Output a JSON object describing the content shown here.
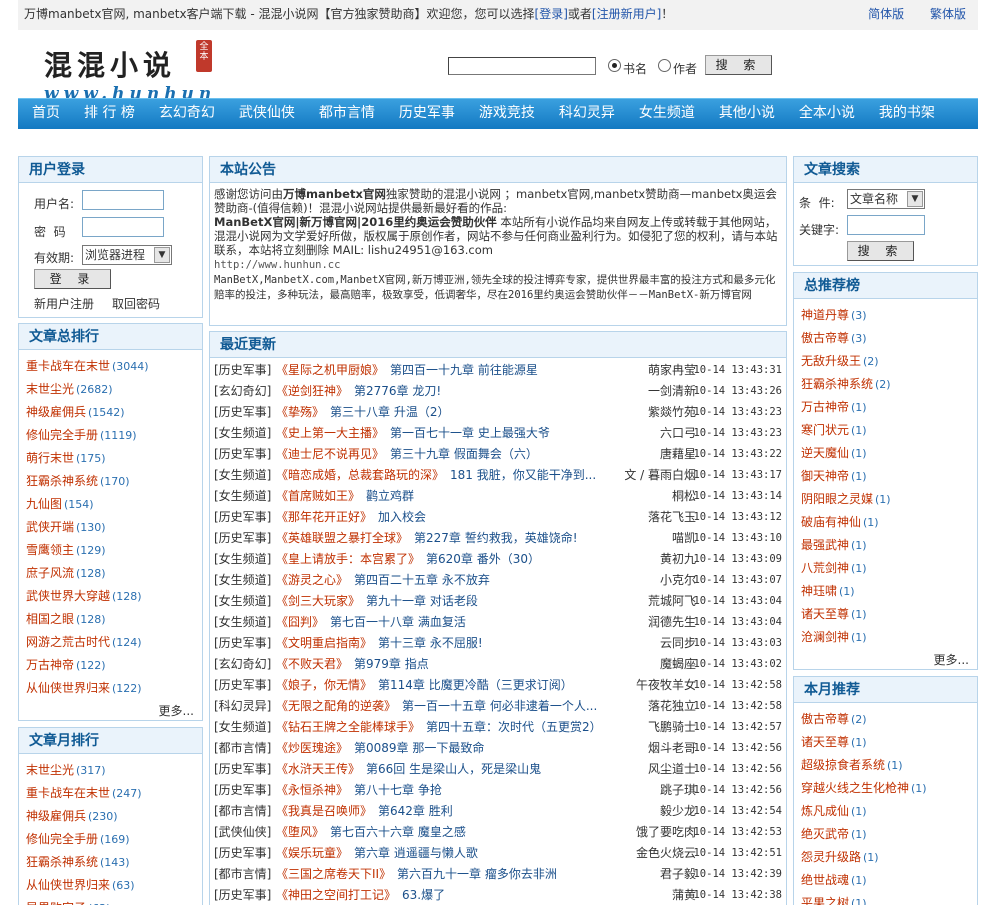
{
  "topbar": {
    "welcome_prefix": "万博manbetx官网, manbetx客户端下载 - 混混小说网【官方独家赞助商】欢迎您，您可以选择",
    "login": "[登录]",
    "or": "或者",
    "register": "[注册新用户]",
    "suffix": "！",
    "simplified": "简体版",
    "traditional": "繁体版"
  },
  "logo": {
    "name": "混混小说",
    "seal": "全本",
    "url": "www.hunhun.cc"
  },
  "search": {
    "value": "",
    "radio_book": "书名",
    "radio_author": "作者",
    "button": "搜 索"
  },
  "nav": [
    "首页",
    "排 行 榜",
    "玄幻奇幻",
    "武侠仙侠",
    "都市言情",
    "历史军事",
    "游戏竞技",
    "科幻灵异",
    "女生频道",
    "其他小说",
    "全本小说",
    "我的书架"
  ],
  "login_box": {
    "title": "用户登录",
    "user_label": "用户名:",
    "pwd_label": "密  码",
    "expire_label": "有效期:",
    "expire_value": "浏览器进程",
    "login_button": "登 录",
    "register_link": "新用户注册",
    "forgot_link": "取回密码"
  },
  "total_rank": {
    "title": "文章总排行",
    "more": "更多...",
    "items": [
      {
        "name": "重卡战车在末世",
        "count": "(3044)"
      },
      {
        "name": "末世尘光",
        "count": "(2682)"
      },
      {
        "name": "神级雇佣兵",
        "count": "(1542)"
      },
      {
        "name": "修仙完全手册",
        "count": "(1119)"
      },
      {
        "name": "萌行末世",
        "count": "(175)"
      },
      {
        "name": "狂霸杀神系统",
        "count": "(170)"
      },
      {
        "name": "九仙图",
        "count": "(154)"
      },
      {
        "name": "武侠开端",
        "count": "(130)"
      },
      {
        "name": "雪鹰领主",
        "count": "(129)"
      },
      {
        "name": "庶子风流",
        "count": "(128)"
      },
      {
        "name": "武侠世界大穿越",
        "count": "(128)"
      },
      {
        "name": "相国之眼",
        "count": "(128)"
      },
      {
        "name": "网游之荒古时代",
        "count": "(124)"
      },
      {
        "name": "万古神帝",
        "count": "(122)"
      },
      {
        "name": "从仙侠世界归来",
        "count": "(122)"
      }
    ]
  },
  "month_rank": {
    "title": "文章月排行",
    "items": [
      {
        "name": "末世尘光",
        "count": "(317)"
      },
      {
        "name": "重卡战车在末世",
        "count": "(247)"
      },
      {
        "name": "神级雇佣兵",
        "count": "(230)"
      },
      {
        "name": "修仙完全手册",
        "count": "(169)"
      },
      {
        "name": "狂霸杀神系统",
        "count": "(143)"
      },
      {
        "name": "从仙侠世界归来",
        "count": "(63)"
      },
      {
        "name": "异界败家子",
        "count": "(62)"
      }
    ]
  },
  "notice": {
    "title": "本站公告",
    "l1a": "感谢您访问由",
    "l1b": "万博manbetx官网",
    "l1c": "独家赞助的混混小说网 ；manbetx官网,manbetx赞助商—manbetx奥运会赞助商-(值得信赖)！混混小说网站提供最新最好看的作品:",
    "l2a": "ManBetX官网|新万博官网|2016里约奥运会赞助伙伴",
    "l2b": " 本站所有小说作品均来自网友上传或转载于其他网站，混混小说网为文学爱好所做，版权属于原创作者，网站不参与任何商业盈利行为。如侵犯了您的权利，请与本站联系，本站将立刻删除 MAIL: lishu24951@163.com",
    "l3": "http://www.hunhun.cc",
    "l4": "ManBetX,ManbetX.com,ManbetX官网,新万博亚洲,领先全球的投注博弈专家，提供世界最丰富的投注方式和最多元化赔率的投注，多种玩法，最高赔率，极致享受，低调奢华，尽在2016里约奥运会赞助伙伴－－ManBetX-新万博官网"
  },
  "updates": {
    "title": "最近更新",
    "rows": [
      {
        "cat": "[历史军事]",
        "title": "《星际之机甲厨娘》",
        "chapter": "第四百一十九章 前往能源星",
        "author": "萌家冉莹",
        "time": "10-14 13:43:31"
      },
      {
        "cat": "[玄幻奇幻]",
        "title": "《逆剑狂神》",
        "chapter": "第2776章 龙刀!",
        "author": "一剑清新",
        "time": "10-14 13:43:26"
      },
      {
        "cat": "[历史军事]",
        "title": "《挚殇》",
        "chapter": "第三十八章 升温（2）",
        "author": "紫燚竹苑",
        "time": "10-14 13:43:23"
      },
      {
        "cat": "[女生频道]",
        "title": "《史上第一大主播》",
        "chapter": "第一百七十一章 史上最强大爷",
        "author": "六口弓",
        "time": "10-14 13:43:23"
      },
      {
        "cat": "[历史军事]",
        "title": "《迪士尼不说再见》",
        "chapter": "第三十九章 假面舞会（六）",
        "author": "唐藉星",
        "time": "10-14 13:43:22"
      },
      {
        "cat": "[女生频道]",
        "title": "《暗恋成婚，总裁套路玩的深》",
        "chapter": "181 我脏，你又能干净到...",
        "author": "文 / 暮雨白烟",
        "time": "10-14 13:43:17"
      },
      {
        "cat": "[女生频道]",
        "title": "《首席贼如王》",
        "chapter": "鹳立鸡群",
        "author": "桐松",
        "time": "10-14 13:43:14"
      },
      {
        "cat": "[历史军事]",
        "title": "《那年花开正好》",
        "chapter": "加入校会",
        "author": "落花飞玉",
        "time": "10-14 13:43:12"
      },
      {
        "cat": "[历史军事]",
        "title": "《英雄联盟之暴打全球》",
        "chapter": "第227章 誓约救我，英雄饶命!",
        "author": "喵凯",
        "time": "10-14 13:43:10"
      },
      {
        "cat": "[女生频道]",
        "title": "《皇上请放手：本宫累了》",
        "chapter": "第620章 番外（30）",
        "author": "黄初九",
        "time": "10-14 13:43:09"
      },
      {
        "cat": "[女生频道]",
        "title": "《游灵之心》",
        "chapter": "第四百二十五章 永不放弃",
        "author": "小克尔",
        "time": "10-14 13:43:07"
      },
      {
        "cat": "[女生频道]",
        "title": "《剑三大玩家》",
        "chapter": "第九十一章 对话老段",
        "author": "荒城阿飞",
        "time": "10-14 13:43:04"
      },
      {
        "cat": "[女生频道]",
        "title": "《囧判》",
        "chapter": "第七百一十八章 满血复活",
        "author": "润德先生",
        "time": "10-14 13:43:04"
      },
      {
        "cat": "[历史军事]",
        "title": "《文明重启指南》",
        "chapter": "第十三章 永不屈服!",
        "author": "云同步",
        "time": "10-14 13:43:03"
      },
      {
        "cat": "[玄幻奇幻]",
        "title": "《不败天君》",
        "chapter": "第979章 指点",
        "author": "魔蝎座",
        "time": "10-14 13:43:02"
      },
      {
        "cat": "[历史军事]",
        "title": "《娘子，你无情》",
        "chapter": "第114章 比魔更冷酷（三更求订阅）",
        "author": "午夜牧羊女",
        "time": "10-14 13:42:58"
      },
      {
        "cat": "[科幻灵异]",
        "title": "《无限之配角的逆袭》",
        "chapter": "第一百一十五章 何必非逮着一个人...",
        "author": "落花独立",
        "time": "10-14 13:42:58"
      },
      {
        "cat": "[女生频道]",
        "title": "《钻石王牌之全能棒球手》",
        "chapter": "第四十五章：次时代（五更赏2）",
        "author": "飞鹏骑士",
        "time": "10-14 13:42:57"
      },
      {
        "cat": "[都市言情]",
        "title": "《炒医瑰途》",
        "chapter": "第0089章 那一下最致命",
        "author": "烟斗老哥",
        "time": "10-14 13:42:56"
      },
      {
        "cat": "[历史军事]",
        "title": "《水浒天王传》",
        "chapter": "第66回 生是梁山人，死是梁山鬼",
        "author": "风尘道士",
        "time": "10-14 13:42:56"
      },
      {
        "cat": "[历史军事]",
        "title": "《永恒杀神》",
        "chapter": "第八十七章 争抢",
        "author": "跳子琪",
        "time": "10-14 13:42:56"
      },
      {
        "cat": "[都市言情]",
        "title": "《我真是召唤师》",
        "chapter": "第642章 胜利",
        "author": "毅少龙",
        "time": "10-14 13:42:54"
      },
      {
        "cat": "[武侠仙侠]",
        "title": "《堕风》",
        "chapter": "第七百六十六章 魔皇之感",
        "author": "饿了要吃肉",
        "time": "10-14 13:42:53"
      },
      {
        "cat": "[历史军事]",
        "title": "《娱乐玩童》",
        "chapter": "第六章 逍遥疆与懒人歌",
        "author": "金色火烧云",
        "time": "10-14 13:42:51"
      },
      {
        "cat": "[都市言情]",
        "title": "《三国之席卷天下II》",
        "chapter": "第六百九十一章 瘤多你去非洲",
        "author": "君子毅",
        "time": "10-14 13:42:39"
      },
      {
        "cat": "[历史军事]",
        "title": "《神田之空间打工记》",
        "chapter": "63.爆了",
        "author": "蒲黄",
        "time": "10-14 13:42:38"
      }
    ]
  },
  "search_box": {
    "title": "文章搜索",
    "cond_label": "条  件:",
    "cond_value": "文章名称",
    "kw_label": "关键字:",
    "button": "搜 索"
  },
  "total_rec": {
    "title": "总推荐榜",
    "more": "更多...",
    "items": [
      {
        "name": "神道丹尊",
        "count": "(3)"
      },
      {
        "name": "傲古帝尊",
        "count": "(3)"
      },
      {
        "name": "无敌升级王",
        "count": "(2)"
      },
      {
        "name": "狂霸杀神系统",
        "count": "(2)"
      },
      {
        "name": "万古神帝",
        "count": "(1)"
      },
      {
        "name": "寒门状元",
        "count": "(1)"
      },
      {
        "name": "逆天魔仙",
        "count": "(1)"
      },
      {
        "name": "御天神帝",
        "count": "(1)"
      },
      {
        "name": "阴阳眼之灵媒",
        "count": "(1)"
      },
      {
        "name": "破庙有神仙",
        "count": "(1)"
      },
      {
        "name": "最强武神",
        "count": "(1)"
      },
      {
        "name": "八荒剑神",
        "count": "(1)"
      },
      {
        "name": "神珏啸",
        "count": "(1)"
      },
      {
        "name": "诸天至尊",
        "count": "(1)"
      },
      {
        "name": "沧澜剑神",
        "count": "(1)"
      }
    ]
  },
  "month_rec": {
    "title": "本月推荐",
    "items": [
      {
        "name": "傲古帝尊",
        "count": "(2)"
      },
      {
        "name": "诸天至尊",
        "count": "(1)"
      },
      {
        "name": "超级掠食者系统",
        "count": "(1)"
      },
      {
        "name": "穿越火线之生化枪神",
        "count": "(1)"
      },
      {
        "name": "炼凡成仙",
        "count": "(1)"
      },
      {
        "name": "绝灭武帝",
        "count": "(1)"
      },
      {
        "name": "怨灵升级路",
        "count": "(1)"
      },
      {
        "name": "绝世战魂",
        "count": "(1)"
      },
      {
        "name": "平果之树",
        "count": "(1)"
      }
    ]
  }
}
